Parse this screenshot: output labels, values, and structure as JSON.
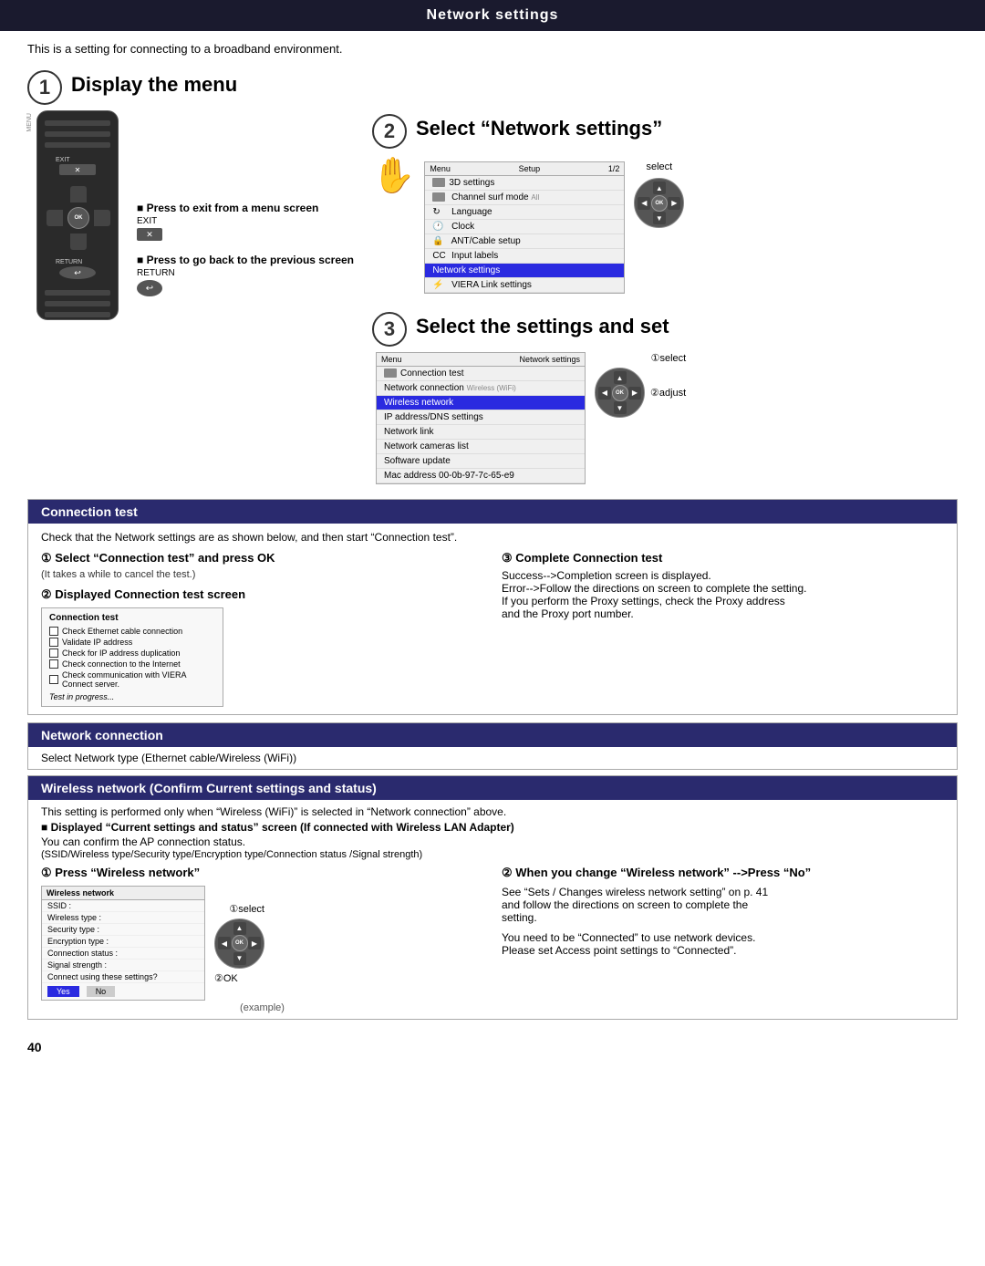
{
  "header": {
    "title": "Network settings"
  },
  "intro": {
    "text": "This is a setting for connecting to a broadband environment."
  },
  "steps": {
    "step1": {
      "number": "1",
      "title": "Display the menu"
    },
    "step2": {
      "number": "2",
      "title": "Select “Network settings”",
      "select_label": "select"
    },
    "step3": {
      "number": "3",
      "title": "Select the settings and set",
      "select_label": "①select",
      "adjust_label": "②adjust"
    }
  },
  "side_notes": {
    "exit_title": "■ Press to exit from a menu screen",
    "exit_btn": "EXIT",
    "return_title": "■ Press to go back to the previous screen",
    "return_btn": "RETURN"
  },
  "menu_mock": {
    "header_left": "Menu",
    "header_right": "Setup",
    "header_page": "1/2",
    "rows": [
      {
        "label": "3D settings",
        "selected": false
      },
      {
        "label": "Channel surf mode",
        "sub": "All",
        "selected": false
      },
      {
        "label": "Language",
        "selected": false
      },
      {
        "label": "Clock",
        "selected": false
      },
      {
        "label": "ANT/Cable setup",
        "selected": false
      },
      {
        "label": "Input labels",
        "selected": false
      },
      {
        "label": "Network settings",
        "selected": true
      },
      {
        "label": "VIERA Link settings",
        "selected": false
      }
    ]
  },
  "network_menu_mock": {
    "header_left": "Menu",
    "header_title": "Network settings",
    "rows": [
      {
        "label": "Connection test",
        "selected": false
      },
      {
        "label": "Network connection",
        "sub": "Wireless (WiFi)",
        "selected": false
      },
      {
        "label": "Wireless network",
        "selected": true
      },
      {
        "label": "IP address/DNS settings",
        "selected": false
      },
      {
        "label": "Network link",
        "selected": false
      },
      {
        "label": "Network cameras list",
        "selected": false
      },
      {
        "label": "Software update",
        "selected": false
      },
      {
        "label": "Mac address    00-0b-97-7c-65-e9",
        "selected": false
      }
    ]
  },
  "connection_test": {
    "section_title": "Connection test",
    "desc": "Check that the Network settings are as shown below, and then start “Connection test”.",
    "step1_title": "① Select “Connection test” and press OK",
    "step1_sub": "(It takes a while to cancel the test.)",
    "step2_title": "② Displayed Connection test screen",
    "step3_title": "③ Complete Connection test",
    "step3_text": "Success-->Completion screen is displayed.\nError-->Follow the directions on screen to complete the setting.\nIf you perform the Proxy settings, check the Proxy address\nand the Proxy port number.",
    "screen_title": "Connection test",
    "screen_rows": [
      "Check Ethernet cable connection",
      "Validate IP address",
      "Check for IP address duplication",
      "Check connection to the Internet",
      "Check communication with VIERA Connect server."
    ],
    "screen_progress": "Test in progress..."
  },
  "network_connection": {
    "section_title": "Network connection",
    "text": "Select Network type (Ethernet cable/Wireless (WiFi))"
  },
  "wireless_network": {
    "section_title": "Wireless network (Confirm Current settings and status)",
    "desc": "This setting is performed only when “Wireless (WiFi)” is selected in “Network connection” above.",
    "note": "■ Displayed “Current settings and status” screen (If connected with Wireless LAN Adapter)",
    "note_sub": "You can confirm the AP connection status.",
    "ssid_note": "(SSID/Wireless type/Security type/Encryption type/Connection status /Signal strength)",
    "step1_title": "① Press “Wireless network”",
    "step2_title": "② When you change “Wireless network” -->Press “No”",
    "step2_text": "See “Sets / Changes wireless network setting” on p. 41\nand follow the directions on screen to complete the\nsetting.",
    "step2_extra": "You need to be “Connected” to use network devices.\nPlease set Access point settings to “Connected”.",
    "select_label": "①select",
    "ok_label": "②OK",
    "screen_title": "Wireless network",
    "screen_rows": [
      {
        "label": "SSID :"
      },
      {
        "label": "Wireless type :"
      },
      {
        "label": "Security type :"
      },
      {
        "label": "Encryption type :"
      },
      {
        "label": "Connection status :"
      },
      {
        "label": "Signal strength :"
      },
      {
        "label": "Connect using these settings?"
      }
    ],
    "btn_yes": "Yes",
    "btn_no": "No",
    "example_label": "(example)"
  },
  "page_number": "40"
}
